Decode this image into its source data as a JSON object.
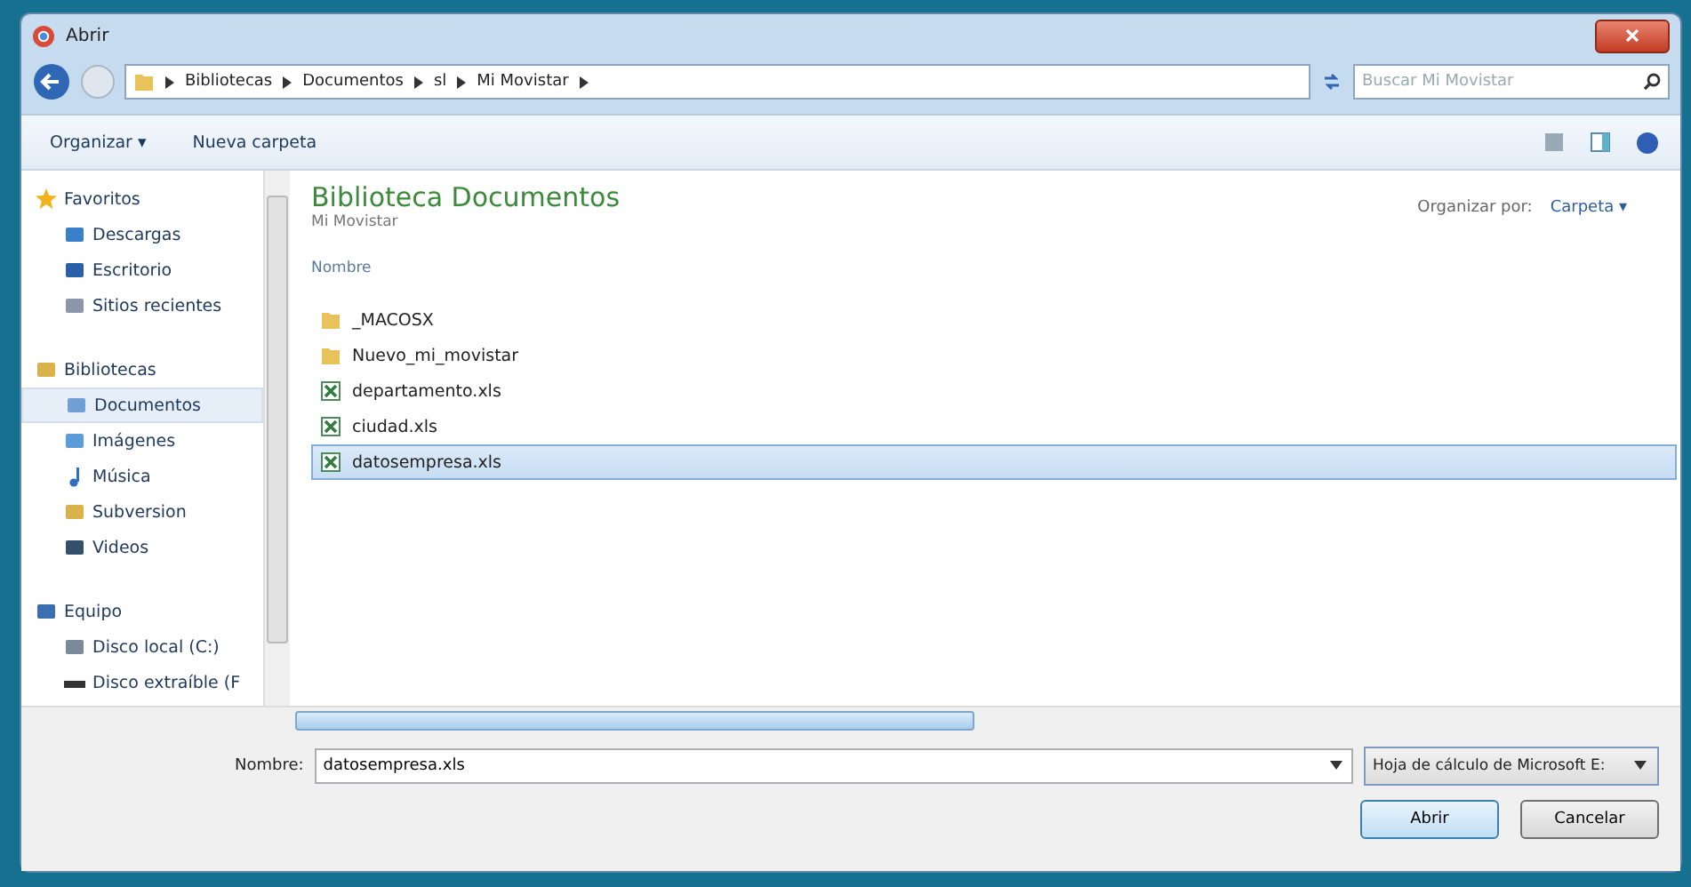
{
  "window": {
    "title": "Abrir"
  },
  "address_bar": {
    "segments": [
      "Bibliotecas",
      "Documentos",
      "sl",
      "Mi Movistar"
    ]
  },
  "search": {
    "placeholder": "Buscar Mi Movistar"
  },
  "toolbar": {
    "buttons": [
      "Organizar ▾",
      "Nueva carpeta"
    ]
  },
  "sidebar": {
    "groups": [
      {
        "label": "Favoritos",
        "selected": false,
        "children": [
          {
            "label": "Descargas",
            "selected": false
          },
          {
            "label": "Escritorio",
            "selected": false
          },
          {
            "label": "Sitios recientes",
            "selected": false
          }
        ]
      },
      {
        "label": "Bibliotecas",
        "selected": false,
        "children": [
          {
            "label": "Documentos",
            "selected": true
          },
          {
            "label": "Imágenes",
            "selected": false
          },
          {
            "label": "Música",
            "selected": false
          },
          {
            "label": "Subversion",
            "selected": false
          },
          {
            "label": "Videos",
            "selected": false
          }
        ]
      },
      {
        "label": "Equipo",
        "selected": false,
        "children": [
          {
            "label": "Disco local (C:)",
            "selected": false
          },
          {
            "label": "Disco extraíble (F",
            "selected": false
          }
        ]
      }
    ]
  },
  "library": {
    "title": "Biblioteca Documentos",
    "subtitle": "Mi Movistar",
    "arrange_label": "Organizar por:",
    "arrange_value": "Carpeta ▾",
    "column": "Nombre"
  },
  "files": [
    {
      "name": "_MACOSX",
      "kind": "folder",
      "selected": false
    },
    {
      "name": "Nuevo_mi_movistar",
      "kind": "folder",
      "selected": false
    },
    {
      "name": "departamento.xls",
      "kind": "sheet",
      "selected": false
    },
    {
      "name": "ciudad.xls",
      "kind": "sheet",
      "selected": false
    },
    {
      "name": "datosempresa.xls",
      "kind": "sheet",
      "selected": true
    }
  ],
  "footer": {
    "filename_label": "Nombre:",
    "filename_value": "datosempresa.xls",
    "filter": "Hoja de cálculo de Microsoft E:",
    "open": "Abrir",
    "cancel": "Cancelar"
  }
}
